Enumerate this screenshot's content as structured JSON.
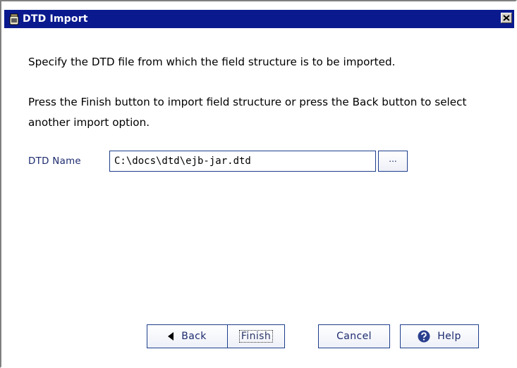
{
  "window": {
    "title": "DTD Import",
    "icon": "jar-icon",
    "close_icon": "close-icon"
  },
  "content": {
    "instruction_1": "Specify the DTD file from which the field structure is to be imported.",
    "instruction_2": "Press the Finish button to import field structure or press the Back button to select another import option."
  },
  "form": {
    "dtd_label": "DTD Name",
    "dtd_value": "C:\\docs\\dtd\\ejb-jar.dtd",
    "browse_label": "..."
  },
  "buttons": {
    "back": "Back",
    "finish": "Finish",
    "cancel": "Cancel",
    "help": "Help"
  },
  "colors": {
    "titlebar": "#0a1a8e",
    "button_border": "#1d3e8c",
    "button_text": "#1c2a6e"
  }
}
